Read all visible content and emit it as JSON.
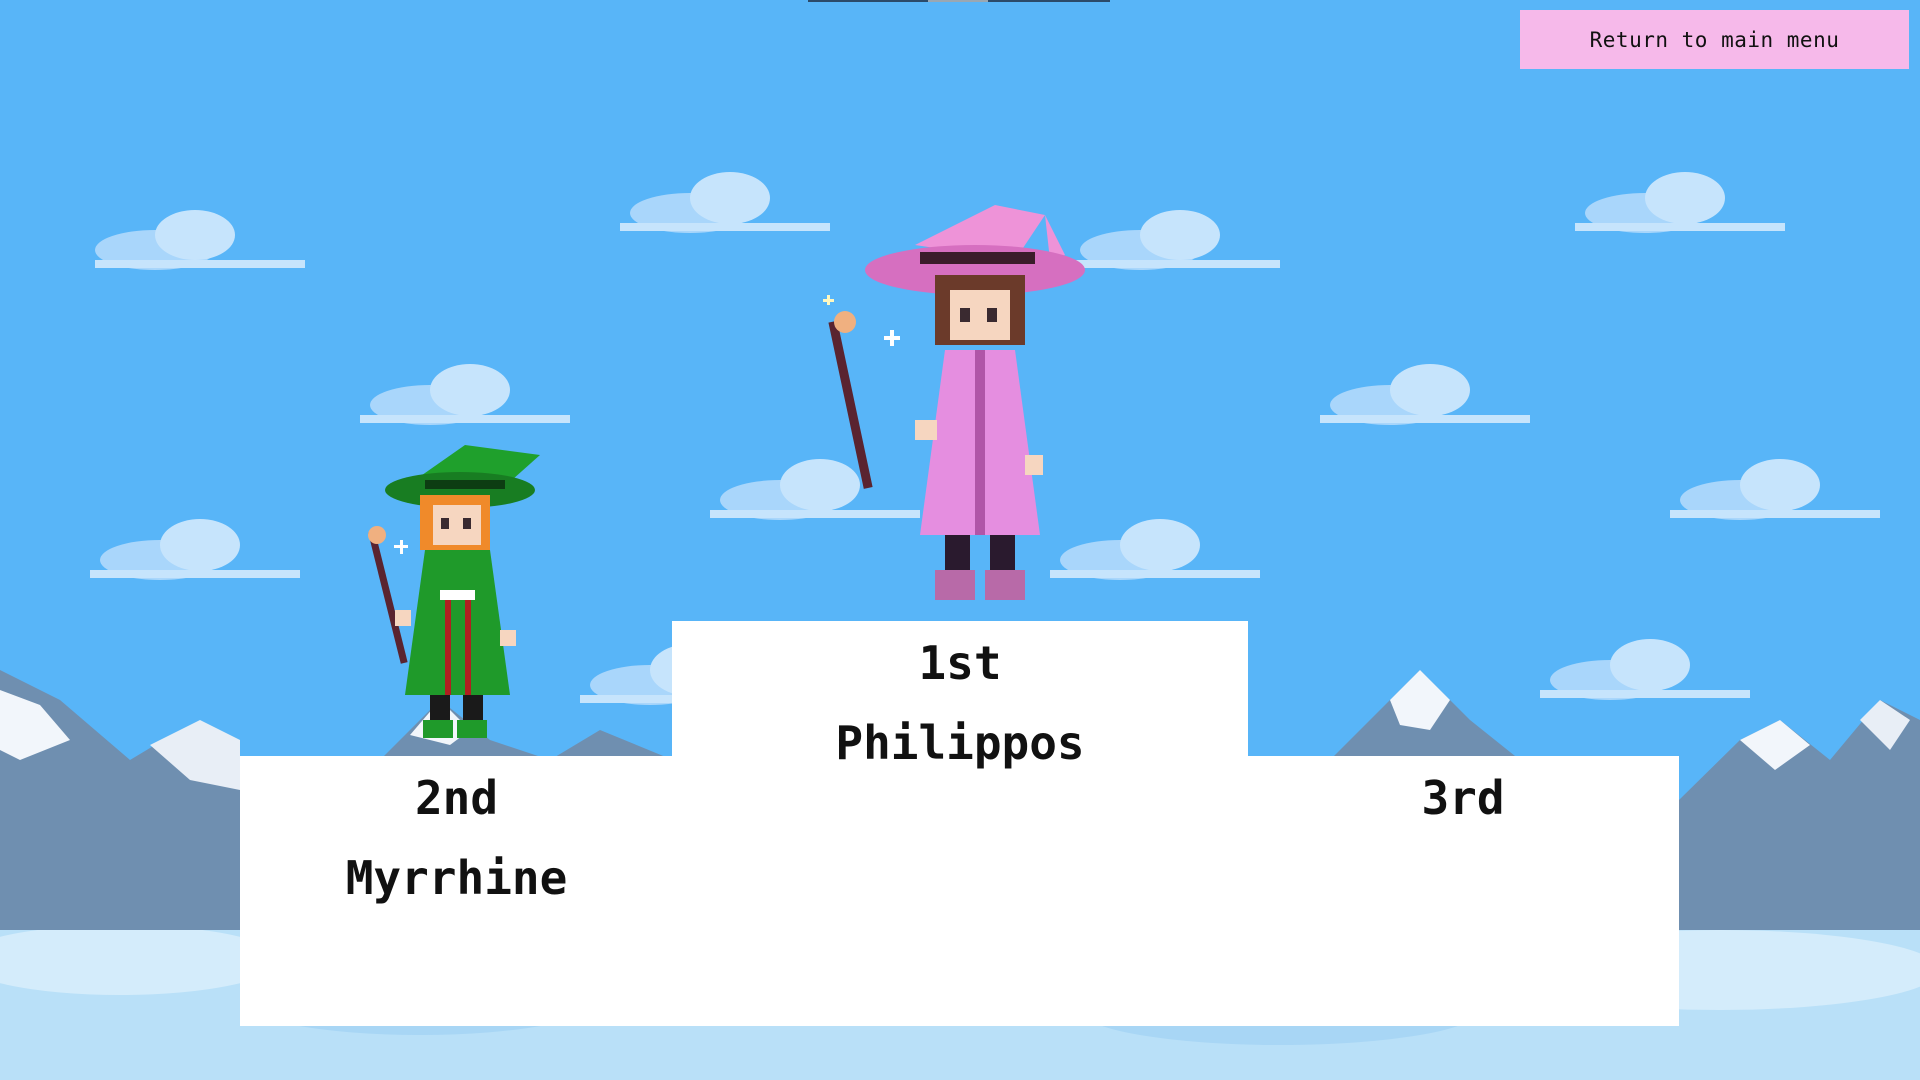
{
  "menu": {
    "return_label": "Return to main menu"
  },
  "podium": {
    "first": {
      "place": "1st",
      "name": "Philippos"
    },
    "second": {
      "place": "2nd",
      "name": "Myrrhine"
    },
    "third": {
      "place": "3rd",
      "name": ""
    }
  },
  "colors": {
    "sky": "#58b5f8",
    "menu_button": "#f6b9ea",
    "podium": "#ffffff",
    "winner_robe": "#e58ee0",
    "runner_up_robe": "#1f9a2a"
  },
  "sprites": {
    "first_place": "pink-wizard-sprite",
    "second_place": "green-wizard-sprite"
  }
}
